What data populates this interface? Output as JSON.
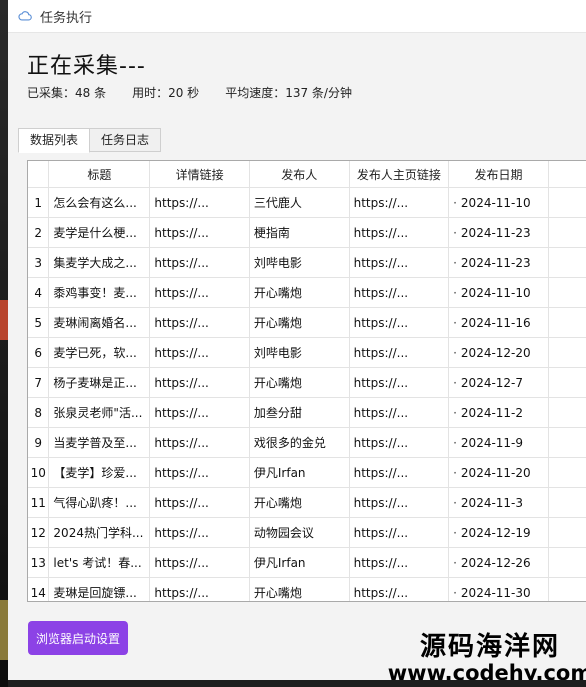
{
  "window": {
    "title": "任务执行"
  },
  "status": {
    "heading": "正在采集---",
    "collected": "已采集：48 条",
    "elapsed": "用时：20 秒",
    "speed": "平均速度：137 条/分钟"
  },
  "tabs": [
    "数据列表",
    "任务日志"
  ],
  "table": {
    "columns": [
      "",
      "标题",
      "详情链接",
      "发布人",
      "发布人主页链接",
      "发布日期"
    ],
    "rows": [
      {
        "idx": "1",
        "title": "怎么会有这么...",
        "link": "https://...",
        "publisher": "三代鹿人",
        "home": "https://...",
        "date": "2024-11-10"
      },
      {
        "idx": "2",
        "title": "麦学是什么梗...",
        "link": "https://...",
        "publisher": "梗指南",
        "home": "https://...",
        "date": "2024-11-23"
      },
      {
        "idx": "3",
        "title": "集麦学大成之...",
        "link": "https://...",
        "publisher": "刘哔电影",
        "home": "https://...",
        "date": "2024-11-23"
      },
      {
        "idx": "4",
        "title": "黍鸡事变！麦...",
        "link": "https://...",
        "publisher": "开心嘴炮",
        "home": "https://...",
        "date": "2024-11-10"
      },
      {
        "idx": "5",
        "title": "麦琳闹离婚名...",
        "link": "https://...",
        "publisher": "开心嘴炮",
        "home": "https://...",
        "date": "2024-11-16"
      },
      {
        "idx": "6",
        "title": "麦学已死，软...",
        "link": "https://...",
        "publisher": "刘哔电影",
        "home": "https://...",
        "date": "2024-12-20"
      },
      {
        "idx": "7",
        "title": "杨子麦琳是正...",
        "link": "https://...",
        "publisher": "开心嘴炮",
        "home": "https://...",
        "date": "2024-12-7"
      },
      {
        "idx": "8",
        "title": "张泉灵老师\"活...",
        "link": "https://...",
        "publisher": "加叁分甜",
        "home": "https://...",
        "date": "2024-11-2"
      },
      {
        "idx": "9",
        "title": "当麦学普及至...",
        "link": "https://...",
        "publisher": "戏很多的金兑",
        "home": "https://...",
        "date": "2024-11-9"
      },
      {
        "idx": "10",
        "title": "【麦学】珍爱...",
        "link": "https://...",
        "publisher": "伊凡Irfan",
        "home": "https://...",
        "date": "2024-11-20"
      },
      {
        "idx": "11",
        "title": "气得心趴疼！...",
        "link": "https://...",
        "publisher": "开心嘴炮",
        "home": "https://...",
        "date": "2024-11-3"
      },
      {
        "idx": "12",
        "title": "2024热门学科...",
        "link": "https://...",
        "publisher": "动物园会议",
        "home": "https://...",
        "date": "2024-12-19"
      },
      {
        "idx": "13",
        "title": "let's 考试！春...",
        "link": "https://...",
        "publisher": "伊凡Irfan",
        "home": "https://...",
        "date": "2024-12-26"
      },
      {
        "idx": "14",
        "title": "麦琳是回旋镖...",
        "link": "https://...",
        "publisher": "开心嘴炮",
        "home": "https://...",
        "date": "2024-11-30"
      }
    ]
  },
  "actions": {
    "browser_settings": "浏览器启动设置"
  },
  "watermark": {
    "line1": "源码海洋网",
    "line2": "www.codehy.com"
  },
  "colors": {
    "accent": "#8c42e6",
    "window_bg": "#f3f3f3"
  }
}
